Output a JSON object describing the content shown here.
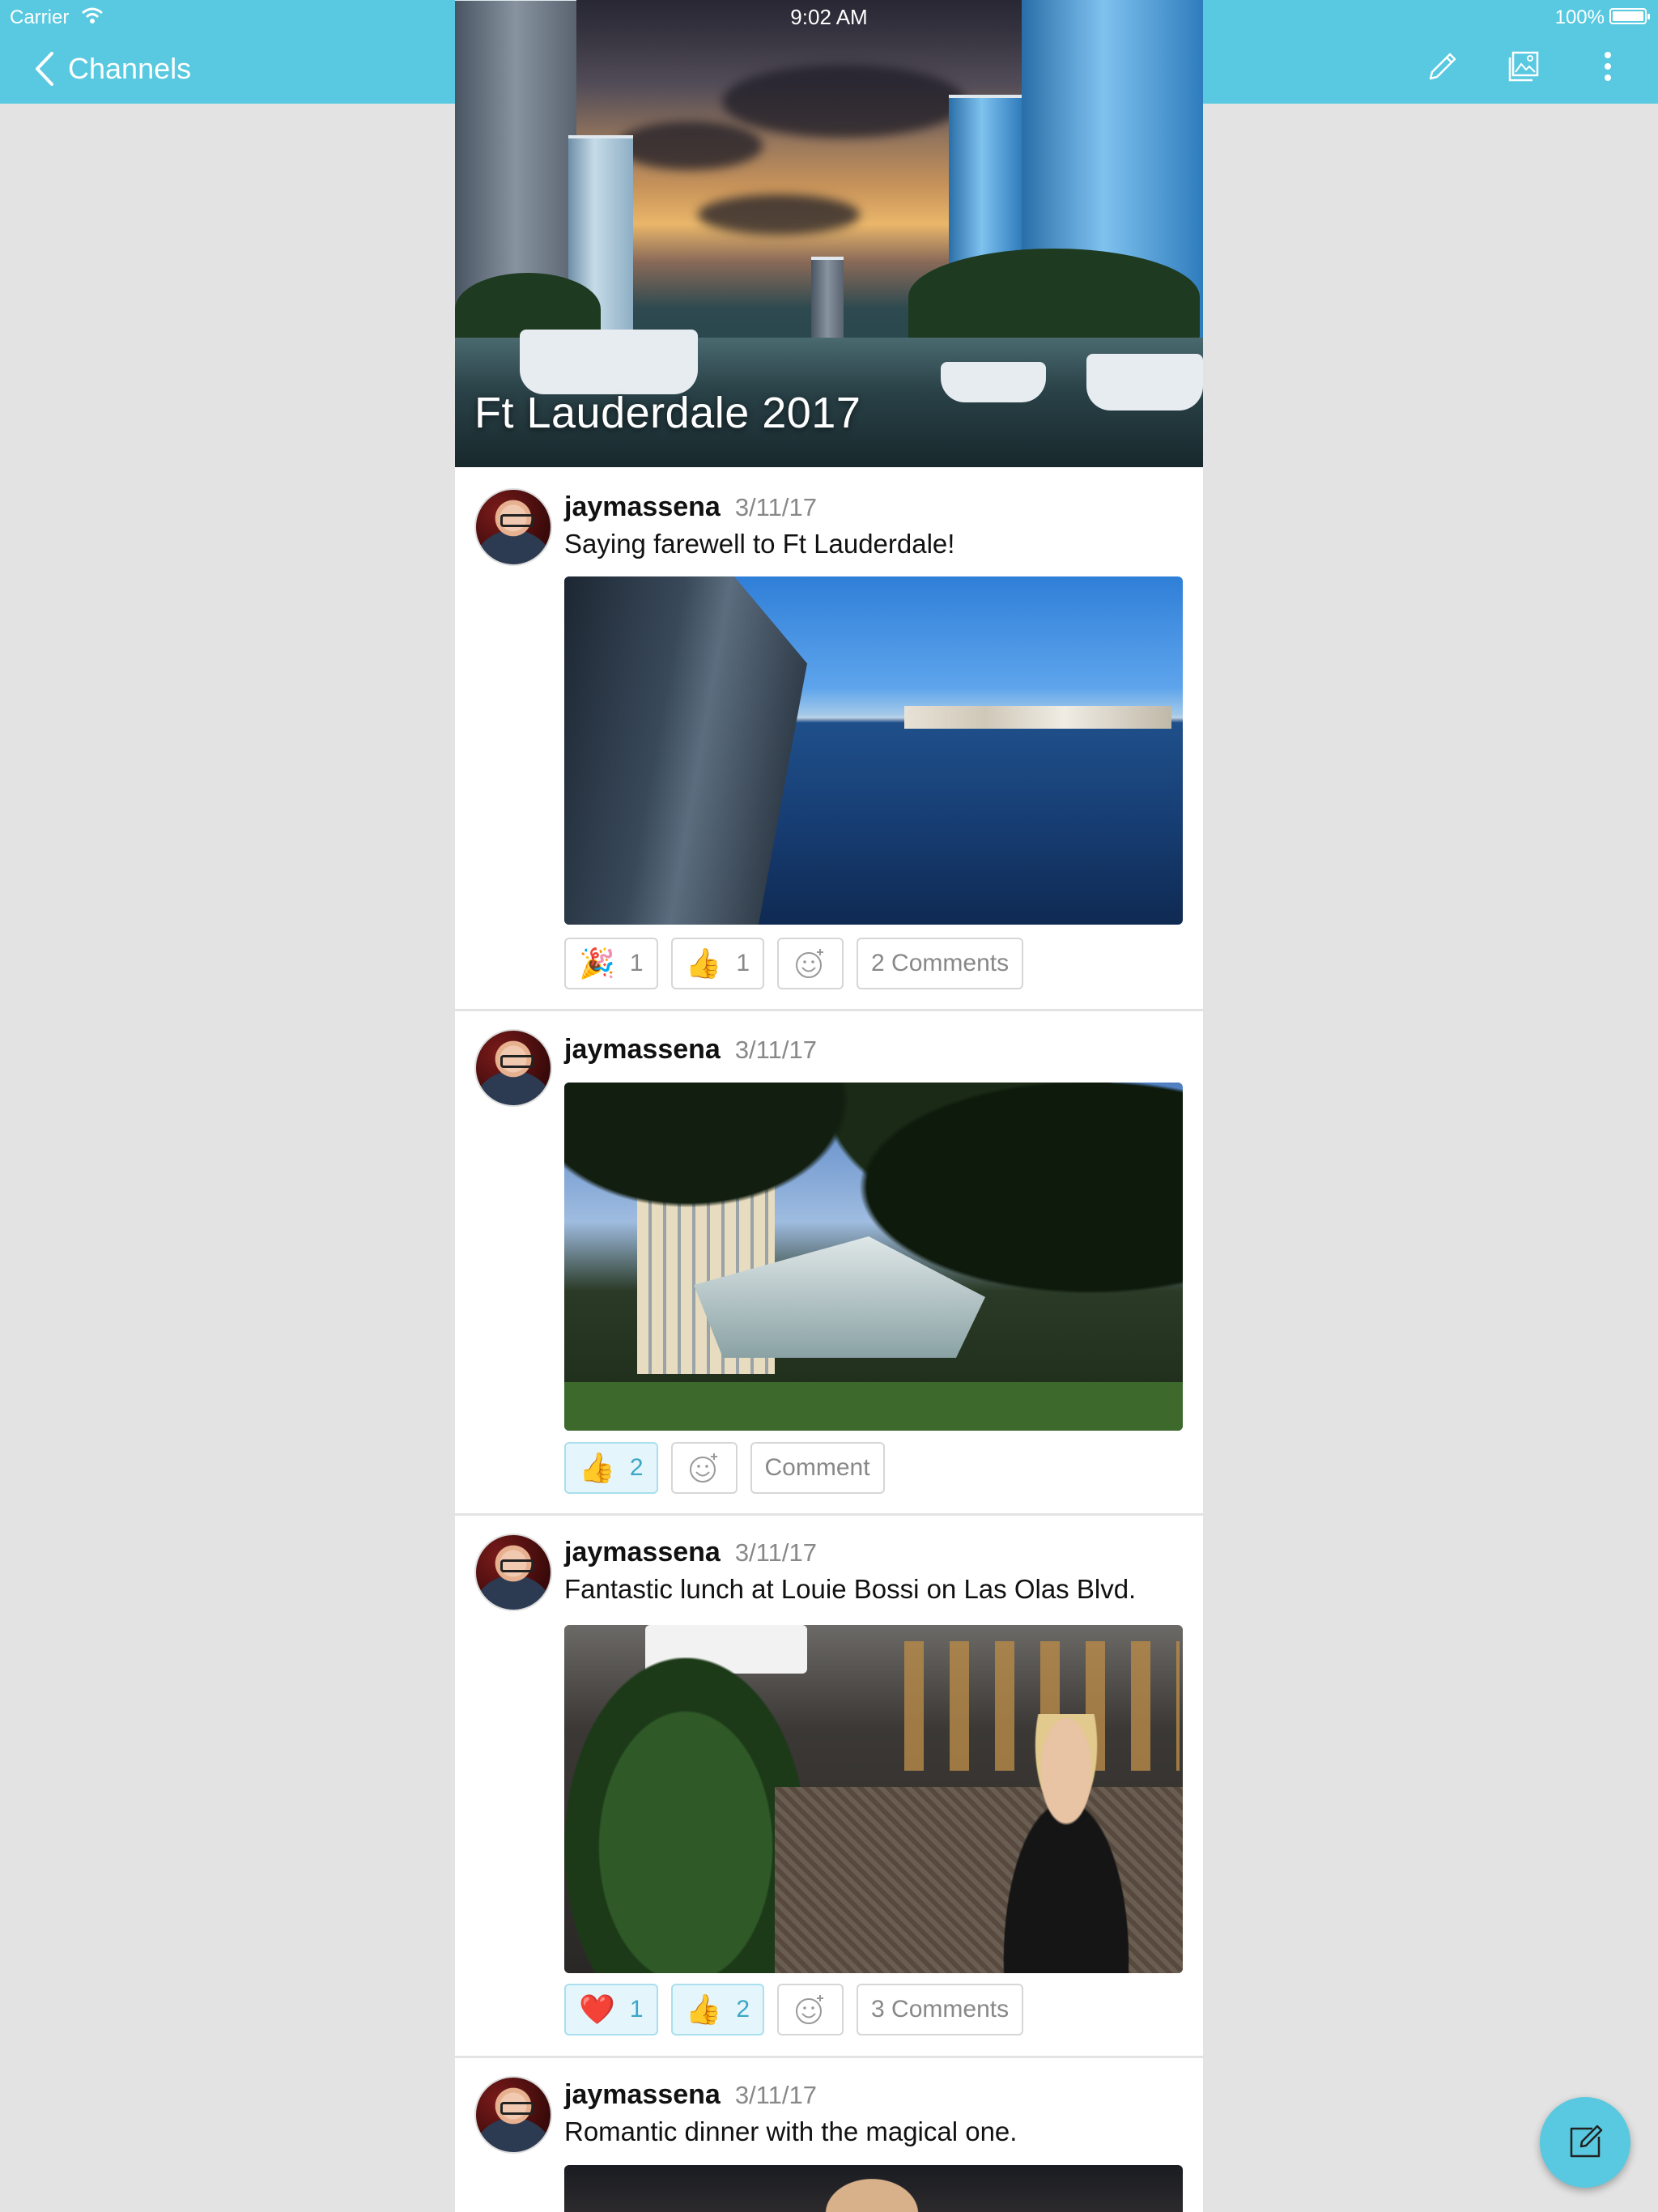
{
  "status_bar": {
    "carrier": "Carrier",
    "time": "9:02 AM",
    "battery": "100%"
  },
  "nav": {
    "back_label": "Channels",
    "icons": [
      "edit-pencil-icon",
      "photo-gallery-icon",
      "more-vertical-icon"
    ]
  },
  "channel": {
    "title": "Ft Lauderdale 2017"
  },
  "posts": [
    {
      "username": "jaymassena",
      "date": "3/11/17",
      "text": "Saying farewell to Ft Lauderdale!",
      "reactions": [
        {
          "emoji": "🎉",
          "count": "1",
          "active": false
        },
        {
          "emoji": "👍",
          "count": "1",
          "active": false
        }
      ],
      "comment_label": "2 Comments"
    },
    {
      "username": "jaymassena",
      "date": "3/11/17",
      "text": "",
      "reactions": [
        {
          "emoji": "👍",
          "count": "2",
          "active": true
        }
      ],
      "comment_label": "Comment"
    },
    {
      "username": "jaymassena",
      "date": "3/11/17",
      "text": "Fantastic lunch at Louie Bossi on Las Olas Blvd.",
      "reactions": [
        {
          "emoji": "❤️",
          "count": "1",
          "active": true
        },
        {
          "emoji": "👍",
          "count": "2",
          "active": true
        }
      ],
      "comment_label": "3 Comments"
    },
    {
      "username": "jaymassena",
      "date": "3/11/17",
      "text": "Romantic dinner with the magical one."
    }
  ],
  "colors": {
    "accent": "#58c9e0",
    "background": "#e3e3e3",
    "active_reaction_bg": "#e4f6fb",
    "active_reaction_text": "#3aa7c7"
  }
}
